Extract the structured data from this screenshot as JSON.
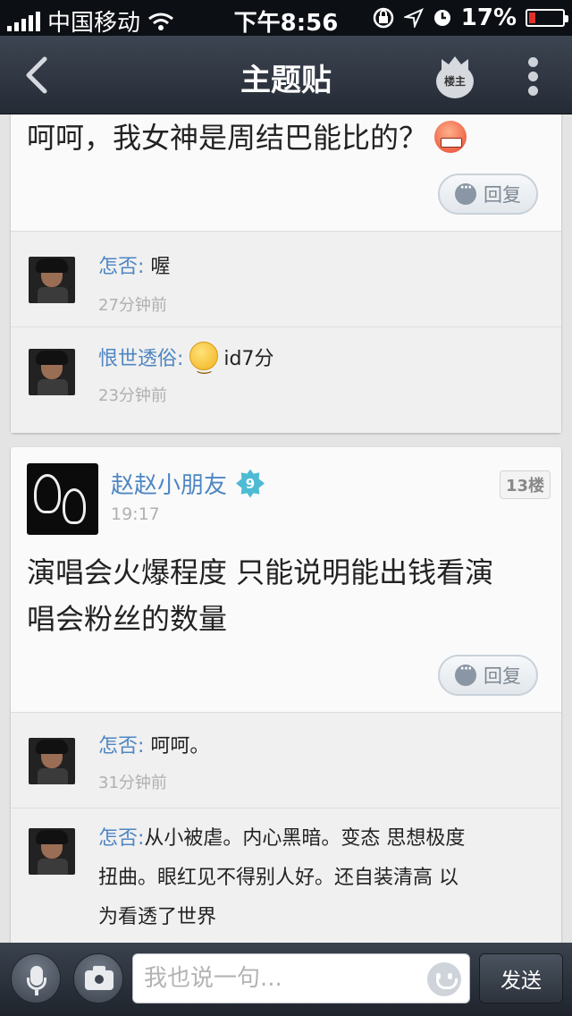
{
  "status_bar": {
    "carrier": "中国移动",
    "time": "下午8:56",
    "battery": "17%",
    "battery_level": 0.17
  },
  "nav": {
    "title": "主题贴",
    "owner_badge": "楼主"
  },
  "post_top": {
    "text": "呵呵，我女神是周结巴能比的？",
    "reply_label": "回复",
    "comments": [
      {
        "user": "怎否:",
        "text": "喔",
        "time": "27分钟前"
      },
      {
        "user": "恨世透俗:",
        "text": "id7分",
        "time": "23分钟前"
      }
    ]
  },
  "post_13": {
    "author": "赵赵小朋友",
    "level": "9",
    "time": "19:17",
    "floor": "13楼",
    "text_line1": "演唱会火爆程度 只能说明能出钱看演",
    "text_line2": "唱会粉丝的数量",
    "reply_label": "回复",
    "comments": [
      {
        "user": "怎否:",
        "text": "呵呵。",
        "time": "31分钟前"
      },
      {
        "user": "怎否:",
        "text_line1": "从小被虐。内心黑暗。变态 思想极度",
        "text_line2": "扭曲。眼红见不得别人好。还自装清高 以",
        "text_line3": "为看透了世界"
      }
    ]
  },
  "compose": {
    "placeholder": "我也说一句...",
    "send_label": "发送"
  },
  "colors": {
    "username": "#4e86c3",
    "nav_bg": "#2f3641",
    "battery_low": "#e0302a"
  }
}
